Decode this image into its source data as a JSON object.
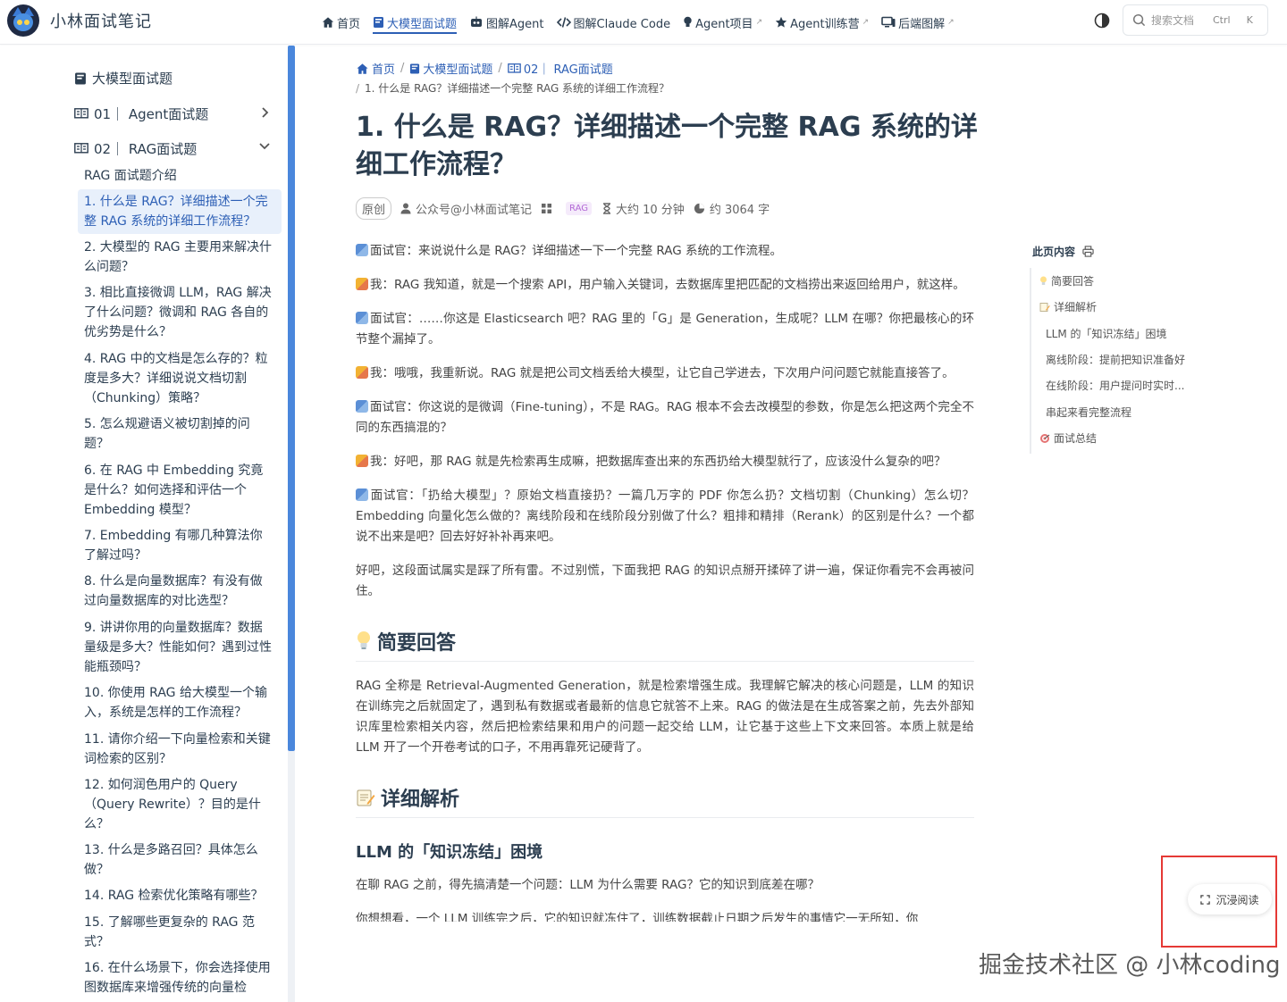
{
  "brand": {
    "title": "小林面试笔记"
  },
  "nav": [
    {
      "label": "首页",
      "icon": "home-icon",
      "active": false,
      "external": false
    },
    {
      "label": "大模型面试题",
      "icon": "book-icon",
      "active": true,
      "external": false
    },
    {
      "label": "图解Agent",
      "icon": "robot-icon",
      "active": false,
      "external": false
    },
    {
      "label": "图解Claude Code",
      "icon": "code-icon",
      "active": false,
      "external": false
    },
    {
      "label": "Agent项目",
      "icon": "bulb-icon",
      "active": false,
      "external": true
    },
    {
      "label": "Agent训练营",
      "icon": "star-icon",
      "active": false,
      "external": true
    },
    {
      "label": "后端图解",
      "icon": "desktop-icon",
      "active": false,
      "external": true
    }
  ],
  "search": {
    "placeholder": "搜索文档",
    "kbd_ctrl": "Ctrl",
    "kbd_key": "K"
  },
  "sidebar": {
    "title": "大模型面试题",
    "sections": [
      {
        "label": "01｜ Agent面试题",
        "expanded": false
      },
      {
        "label": "02｜ RAG面试题",
        "expanded": true
      }
    ],
    "items": [
      "RAG 面试题介绍",
      "1. 什么是 RAG？详细描述一个完整 RAG 系统的详细工作流程？",
      "2. 大模型的 RAG 主要用来解决什么问题？",
      "3. 相比直接微调 LLM，RAG 解决了什么问题？微调和 RAG 各自的优劣势是什么？",
      "4. RAG 中的文档是怎么存的？粒度是多大？详细说说文档切割（Chunking）策略？",
      "5. 怎么规避语义被切割掉的问题？",
      "6. 在 RAG 中 Embedding 究竟是什么？如何选择和评估一个 Embedding 模型？",
      "7. Embedding 有哪几种算法你了解过吗？",
      "8. 什么是向量数据库？有没有做过向量数据库的对比选型？",
      "9. 讲讲你用的向量数据库？数据量级是多大？性能如何？遇到过性能瓶颈吗？",
      "10. 你使用 RAG 给大模型一个输入，系统是怎样的工作流程？",
      "11. 请你介绍一下向量检索和关键词检索的区别？",
      "12. 如何润色用户的 Query（Query Rewrite）？目的是什么？",
      "13. 什么是多路召回？具体怎么做？",
      "14. RAG 检索优化策略有哪些？",
      "15. 了解哪些更复杂的 RAG 范式？",
      "16. 在什么场景下，你会选择使用图数据库来增强传统的向量检"
    ],
    "active_index": 1
  },
  "breadcrumb": {
    "home": "首页",
    "section": "大模型面试题",
    "sub": "02｜ RAG面试题",
    "current": "1. 什么是 RAG？详细描述一个完整 RAG 系统的详细工作流程？"
  },
  "page": {
    "title": "1. 什么是 RAG？详细描述一个完整 RAG 系统的详细工作流程？",
    "meta": {
      "badge": "原创",
      "author": "公众号@小林面试笔记",
      "tag": "RAG",
      "reading_time": "大约 10 分钟",
      "word_count": "约 3064 字"
    }
  },
  "article": {
    "dialogue": [
      {
        "role": "interviewer",
        "speaker": "面试官",
        "text": "来说说什么是 RAG？详细描述一下一个完整 RAG 系统的工作流程。"
      },
      {
        "role": "me",
        "speaker": "我",
        "text": "RAG 我知道，就是一个搜索 API，用户输入关键词，去数据库里把匹配的文档捞出来返回给用户，就这样。"
      },
      {
        "role": "interviewer",
        "speaker": "面试官",
        "text": "……你这是 Elasticsearch 吧？RAG 里的「G」是 Generation，生成呢？LLM 在哪？你把最核心的环节整个漏掉了。"
      },
      {
        "role": "me",
        "speaker": "我",
        "text": "哦哦，我重新说。RAG 就是把公司文档丢给大模型，让它自己学进去，下次用户问问题它就能直接答了。"
      },
      {
        "role": "interviewer",
        "speaker": "面试官",
        "text": "你这说的是微调（Fine-tuning），不是 RAG。RAG 根本不会去改模型的参数，你是怎么把这两个完全不同的东西搞混的？"
      },
      {
        "role": "me",
        "speaker": "我",
        "text": "好吧，那 RAG 就是先检索再生成嘛，把数据库查出来的东西扔给大模型就行了，应该没什么复杂的吧？"
      },
      {
        "role": "interviewer",
        "speaker": "面试官",
        "text": "「扔给大模型」？原始文档直接扔？一篇几万字的 PDF 你怎么扔？文档切割（Chunking）怎么切？Embedding 向量化怎么做的？离线阶段和在线阶段分别做了什么？粗排和精排（Rerank）的区别是什么？一个都说不出来是吧？回去好好补补再来吧。"
      }
    ],
    "outro": "好吧，这段面试属实是踩了所有雷。不过别慌，下面我把 RAG 的知识点掰开揉碎了讲一遍，保证你看完不会再被问住。",
    "h2_summary": "简要回答",
    "summary": "RAG 全称是 Retrieval-Augmented Generation，就是检索增强生成。我理解它解决的核心问题是，LLM 的知识在训练完之后就固定了，遇到私有数据或者最新的信息它就答不上来。RAG 的做法是在生成答案之前，先去外部知识库里检索相关内容，然后把检索结果和用户的问题一起交给 LLM，让它基于这些上下文来回答。本质上就是给 LLM 开了一个开卷考试的口子，不用再靠死记硬背了。",
    "h2_detail": "详细解析",
    "h3_frozen": "LLM 的「知识冻结」困境",
    "frozen_intro": "在聊 RAG 之前，得先搞清楚一个问题：LLM 为什么需要 RAG？它的知识到底差在哪？",
    "frozen_cut": "你想想看，一个 LLM 训练完之后，它的知识就冻住了，训练数据截止日期之后发生的事情它一无所知，你"
  },
  "toc": {
    "title": "此页内容",
    "items": [
      {
        "label": "简要回答",
        "level": 1,
        "icon": "bulb-icon"
      },
      {
        "label": "详细解析",
        "level": 1,
        "icon": "memo-icon"
      },
      {
        "label": "LLM 的「知识冻结」困境",
        "level": 2
      },
      {
        "label": "离线阶段：提前把知识准备好",
        "level": 2
      },
      {
        "label": "在线阶段：用户提问时实时...",
        "level": 2
      },
      {
        "label": "串起来看完整流程",
        "level": 2
      },
      {
        "label": "面试总结",
        "level": 1,
        "icon": "target-icon"
      }
    ]
  },
  "immersive": {
    "label": "沉浸阅读"
  },
  "watermark": "掘金技术社区 @ 小林coding",
  "colors": {
    "accent": "#2d5fb5",
    "scrollbar": "#4a87dc",
    "highlight": "#e53935",
    "tag": "#b36ad6"
  }
}
